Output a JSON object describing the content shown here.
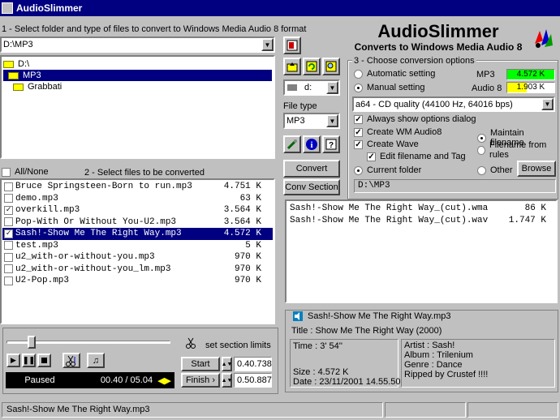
{
  "window": {
    "title": "AudioSlimmer"
  },
  "step1": {
    "label": "1 - Select folder and type of files to convert to Windows Media Audio 8 format",
    "path": "D:\\MP3"
  },
  "tree": [
    {
      "label": "D:\\",
      "selected": false
    },
    {
      "label": "MP3",
      "selected": true
    },
    {
      "label": "Grabbati",
      "selected": false
    }
  ],
  "drive": "d:",
  "filetype": {
    "label": "File type",
    "value": "MP3"
  },
  "header": {
    "title": "AudioSlimmer",
    "subtitle": "Converts to Windows Media Audio 8"
  },
  "step3": {
    "label": "3 - Choose conversion options",
    "automatic": "Automatic setting",
    "manual": "Manual setting",
    "mp3_label": "MP3",
    "mp3_size": "4.572 K",
    "audio8_label": "Audio 8",
    "audio8_size": "1.903 K",
    "quality": "a64 - CD quality (44100 Hz, 64016 bps)",
    "always_show": "Always show options dialog",
    "create_wm": "Create WM Audio8",
    "create_wave": "Create Wave",
    "edit_filename": "Edit filename and Tag",
    "maintain": "Maintain filename",
    "from_rules": "Filename from rules",
    "current_folder": "Current folder",
    "other": "Other",
    "browse": "Browse",
    "output_path": "D:\\MP3"
  },
  "step2": {
    "all_none": "All/None",
    "label": "2 - Select files to be converted"
  },
  "files": [
    {
      "name": "Bruce Springsteen-Born to run.mp3",
      "size": "4.751 K",
      "checked": false,
      "selected": false
    },
    {
      "name": "demo.mp3",
      "size": "63 K",
      "checked": false,
      "selected": false
    },
    {
      "name": "overkill.mp3",
      "size": "3.564 K",
      "checked": true,
      "selected": false
    },
    {
      "name": "Pop-With Or Without You-U2.mp3",
      "size": "3.564 K",
      "checked": false,
      "selected": false
    },
    {
      "name": "Sash!-Show Me The Right Way.mp3",
      "size": "4.572 K",
      "checked": true,
      "selected": true
    },
    {
      "name": "test.mp3",
      "size": "5 K",
      "checked": false,
      "selected": false
    },
    {
      "name": "u2_with-or-without-you.mp3",
      "size": "970 K",
      "checked": false,
      "selected": false
    },
    {
      "name": "u2_with-or-without-you_lm.mp3",
      "size": "970 K",
      "checked": false,
      "selected": false
    },
    {
      "name": "U2-Pop.mp3",
      "size": "970 K",
      "checked": false,
      "selected": false
    }
  ],
  "buttons": {
    "convert": "Convert",
    "conv_section": "Conv Section",
    "start": "Start",
    "finish": "Finish"
  },
  "output_files": [
    {
      "name": "Sash!-Show Me The Right Way_(cut).wma",
      "size": "86 K"
    },
    {
      "name": "Sash!-Show Me The Right Way_(cut).wav",
      "size": "1.747 K"
    }
  ],
  "info": {
    "filename": "Sash!-Show Me The Right Way.mp3",
    "title": "Title : Show Me The Right Way  (2000)",
    "time": "Time : 3' 54''",
    "size": "Size  : 4.572 K",
    "date": "Date : 23/11/2001 14.55.50",
    "artist": "Artist : Sash!",
    "album": "Album : Trilenium",
    "genre": "Genre : Dance",
    "comment": "Ripped by Crustef !!!!"
  },
  "player": {
    "set_section": "set section limits",
    "status": "Paused",
    "time": "00.40 / 05.04",
    "start_value": "0.40.738",
    "finish_value": "0.50.887",
    "position_fraction": 0.13
  },
  "statusbar": {
    "text": "Sash!-Show Me The Right Way.mp3"
  },
  "colors": {
    "titlebar": "#000080",
    "selection": "#000080",
    "mp3_bar": "#00ff00",
    "audio8_bar": "#ffff00"
  }
}
